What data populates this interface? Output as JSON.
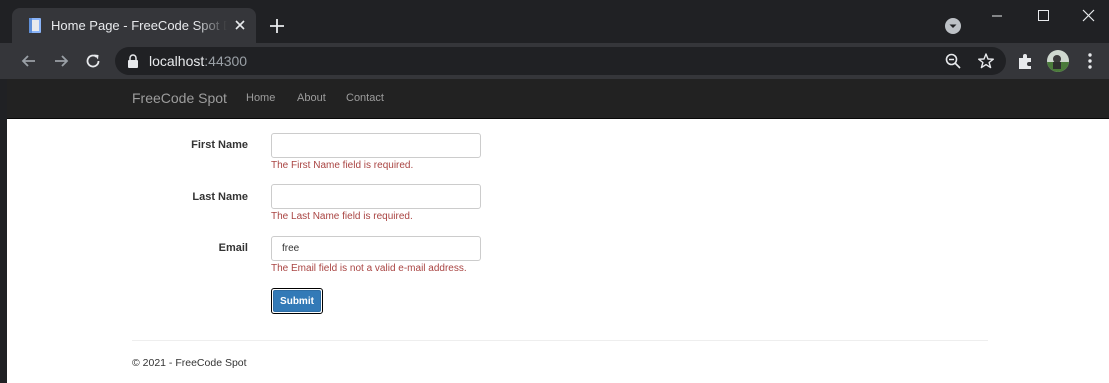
{
  "browser": {
    "tab_title": "Home Page - FreeCode Spot Demo",
    "url_host": "localhost",
    "url_port": ":44300"
  },
  "navbar": {
    "brand": "FreeCode Spot",
    "links": [
      "Home",
      "About",
      "Contact"
    ]
  },
  "form": {
    "fields": [
      {
        "label": "First Name",
        "value": "",
        "error": "The First Name field is required."
      },
      {
        "label": "Last Name",
        "value": "",
        "error": "The Last Name field is required."
      },
      {
        "label": "Email",
        "value": "free",
        "error": "The Email field is not a valid e-mail address."
      }
    ],
    "submit_label": "Submit"
  },
  "footer": {
    "text": "© 2021 - FreeCode Spot"
  },
  "colors": {
    "error": "#a94442",
    "button": "#337ab7",
    "navbar": "#222222"
  }
}
